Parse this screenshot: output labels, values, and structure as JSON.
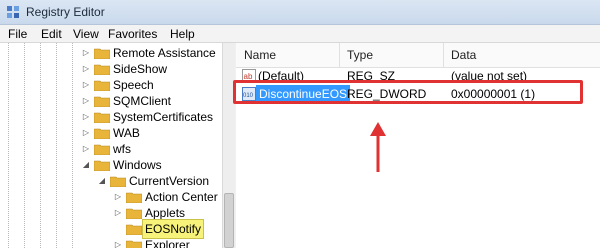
{
  "window": {
    "title": "Registry Editor"
  },
  "menu": [
    "File",
    "Edit",
    "View",
    "Favorites",
    "Help"
  ],
  "tree": {
    "items": [
      {
        "label": "Remote Assistance",
        "level": 0,
        "expander": "collapsed",
        "selected": false
      },
      {
        "label": "SideShow",
        "level": 0,
        "expander": "collapsed",
        "selected": false
      },
      {
        "label": "Speech",
        "level": 0,
        "expander": "collapsed",
        "selected": false
      },
      {
        "label": "SQMClient",
        "level": 0,
        "expander": "collapsed",
        "selected": false
      },
      {
        "label": "SystemCertificates",
        "level": 0,
        "expander": "collapsed",
        "selected": false
      },
      {
        "label": "WAB",
        "level": 0,
        "expander": "collapsed",
        "selected": false
      },
      {
        "label": "wfs",
        "level": 0,
        "expander": "collapsed",
        "selected": false
      },
      {
        "label": "Windows",
        "level": 0,
        "expander": "expanded",
        "selected": false
      },
      {
        "label": "CurrentVersion",
        "level": 1,
        "expander": "expanded",
        "selected": false
      },
      {
        "label": "Action Center",
        "level": 2,
        "expander": "collapsed",
        "selected": false
      },
      {
        "label": "Applets",
        "level": 2,
        "expander": "collapsed",
        "selected": false
      },
      {
        "label": "EOSNotify",
        "level": 2,
        "expander": "none",
        "selected": true
      },
      {
        "label": "Explorer",
        "level": 2,
        "expander": "collapsed",
        "selected": false
      }
    ]
  },
  "values": {
    "columns": {
      "name": "Name",
      "type": "Type",
      "data": "Data"
    },
    "rows": [
      {
        "name": "(Default)",
        "type": "REG_SZ",
        "data": "(value not set)",
        "icon": "ab",
        "selected": false
      },
      {
        "name": "DiscontinueEOS",
        "type": "REG_DWORD",
        "data": "0x00000001 (1)",
        "icon": "dword",
        "selected": true
      }
    ]
  },
  "icons": {
    "app": "registry-icon",
    "folder": "folder-icon",
    "string_value": "string-value-icon",
    "dword_value": "dword-value-icon"
  },
  "colors": {
    "selection_blue": "#3399ff",
    "highlight_red": "#e03232",
    "tree_selected": "#f7f27a",
    "folder": "#e8b43a"
  }
}
